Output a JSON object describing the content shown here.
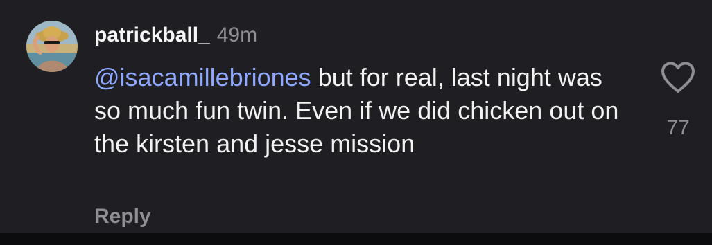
{
  "comment": {
    "username": "patrickball_",
    "timestamp": "49m",
    "mention": "@isacamillebriones",
    "text": " but for real, last night was so much fun twin. Even if we did chicken out on the kirsten and jesse mission",
    "reply_label": "Reply",
    "like_count": "77",
    "like_icon": "heart-outline-icon",
    "avatar_icon": "profile-photo"
  },
  "colors": {
    "background": "#1e1e23",
    "mention": "#8ea8ff",
    "muted": "#8e8e93",
    "text": "#f2f2f2"
  }
}
